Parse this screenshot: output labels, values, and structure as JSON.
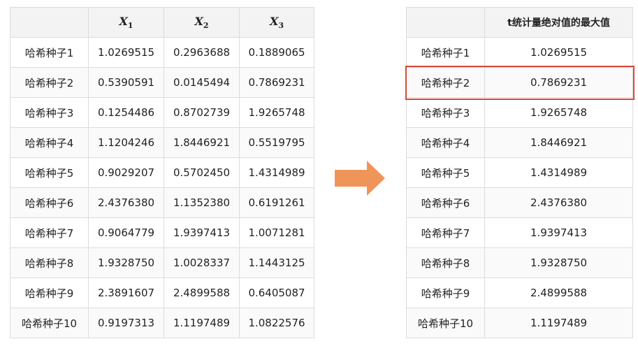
{
  "left_table": {
    "headers": [
      "",
      "X",
      "X",
      "X"
    ],
    "header_subs": [
      "",
      "1",
      "2",
      "3"
    ],
    "rows": [
      [
        "哈希种子1",
        "1.0269515",
        "0.2963688",
        "0.1889065"
      ],
      [
        "哈希种子2",
        "0.5390591",
        "0.0145494",
        "0.7869231"
      ],
      [
        "哈希种子3",
        "0.1254486",
        "0.8702739",
        "1.9265748"
      ],
      [
        "哈希种子4",
        "1.1204246",
        "1.8446921",
        "0.5519795"
      ],
      [
        "哈希种子5",
        "0.9029207",
        "0.5702450",
        "1.4314989"
      ],
      [
        "哈希种子6",
        "2.4376380",
        "1.1352380",
        "0.6191261"
      ],
      [
        "哈希种子7",
        "0.9064779",
        "1.9397413",
        "1.0071281"
      ],
      [
        "哈希种子8",
        "1.9328750",
        "1.0028337",
        "1.1443125"
      ],
      [
        "哈希种子9",
        "2.3891607",
        "2.4899588",
        "0.6405087"
      ],
      [
        "哈希种子10",
        "0.9197313",
        "1.1197489",
        "1.0822576"
      ]
    ]
  },
  "right_table": {
    "headers": [
      "",
      "t统计量绝对值的最大值"
    ],
    "rows": [
      [
        "哈希种子1",
        "1.0269515"
      ],
      [
        "哈希种子2",
        "0.7869231"
      ],
      [
        "哈希种子3",
        "1.9265748"
      ],
      [
        "哈希种子4",
        "1.8446921"
      ],
      [
        "哈希种子5",
        "1.4314989"
      ],
      [
        "哈希种子6",
        "2.4376380"
      ],
      [
        "哈希种子7",
        "1.9397413"
      ],
      [
        "哈希种子8",
        "1.9328750"
      ],
      [
        "哈希种子9",
        "2.4899588"
      ],
      [
        "哈希种子10",
        "1.1197489"
      ]
    ],
    "highlighted_row": 1
  },
  "colors": {
    "arrow": "#f0955a",
    "highlight": "#d9483b",
    "header_bg": "#f3f3f3",
    "border": "#dcdcdc"
  }
}
